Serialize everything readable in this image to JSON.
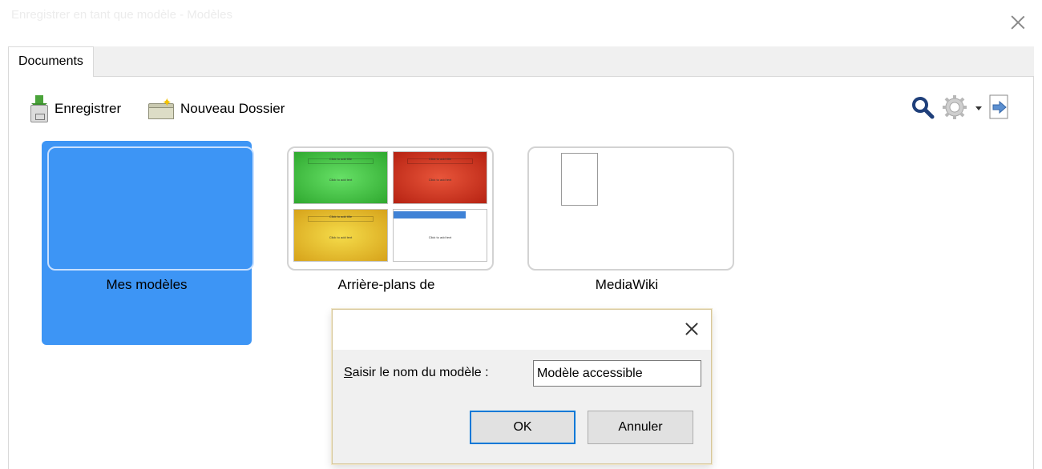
{
  "window": {
    "title": "Enregistrer en tant que modèle - Modèles"
  },
  "tabs": [
    {
      "label": "Documents"
    }
  ],
  "toolbar": {
    "save_label": "Enregistrer",
    "new_folder_label": "Nouveau Dossier",
    "save_icon": "save-icon",
    "new_folder_icon": "new-folder-icon",
    "search_icon": "search-icon",
    "settings_icon": "gear-icon",
    "dropdown_icon": "dropdown-arrow-icon",
    "export_icon": "export-icon"
  },
  "templates": [
    {
      "label": "Mes modèles",
      "selected": true
    },
    {
      "label": "Arrière-plans de",
      "selected": false
    },
    {
      "label": "MediaWiki",
      "selected": false
    }
  ],
  "dialog": {
    "label_prefix": "S",
    "label_rest": "aisir le nom du modèle :",
    "input_value": "Modèle accessible",
    "ok_label": "OK",
    "cancel_label": "Annuler"
  },
  "colors": {
    "selection": "#3d95f5",
    "tab_strip": "#f0f0f0",
    "dialog_body": "#f0f0f0",
    "ok_border": "#0078d7"
  }
}
